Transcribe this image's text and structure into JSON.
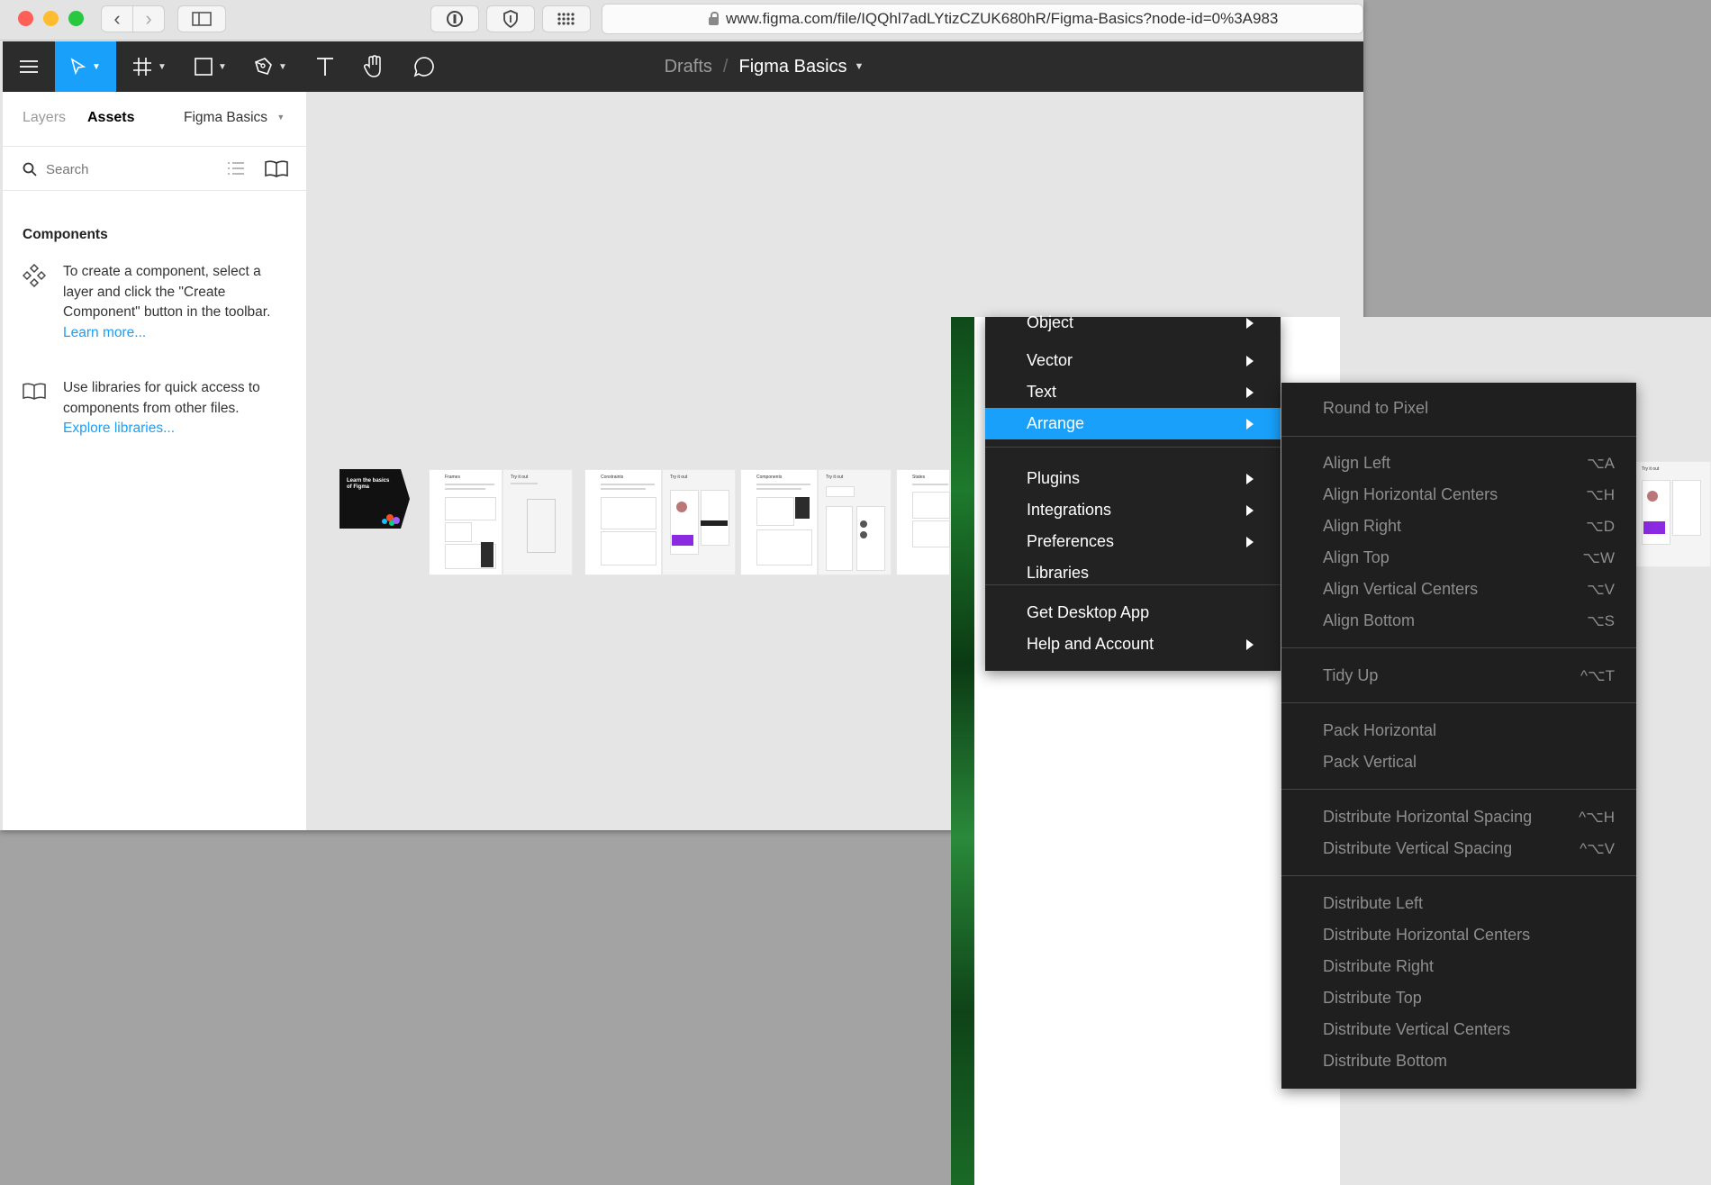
{
  "browser": {
    "url": "www.figma.com/file/IQQhl7adLYtizCZUK680hR/Figma-Basics?node-id=0%3A983",
    "traffic_colors": [
      "#fe5f57",
      "#febc2e",
      "#28c840"
    ]
  },
  "toolbar": {
    "crumb_parent": "Drafts",
    "crumb_separator": "/",
    "crumb_current": "Figma Basics",
    "accent": "#18a0fb"
  },
  "left_panel": {
    "tab_layers": "Layers",
    "tab_assets": "Assets",
    "file_name": "Figma Basics",
    "search_placeholder": "Search",
    "components_heading": "Components",
    "components_text": "To create a component, select a layer and click the \"Create Component\" button in the toolbar.",
    "components_link": "Learn more...",
    "libraries_text": "Use libraries for quick access to components from other files.",
    "libraries_link": "Explore libraries..."
  },
  "canvas": {
    "cover_title": "Learn the basics of Figma",
    "frame_titles": [
      "Frames",
      "Try it out",
      "Constraints",
      "Try it out",
      "Components",
      "Try it out",
      "States"
    ]
  },
  "main_menu": {
    "cut_off_item": "Object",
    "items": [
      {
        "label": "Vector",
        "submenu": true
      },
      {
        "label": "Text",
        "submenu": true
      },
      {
        "label": "Arrange",
        "submenu": true,
        "highlighted": true
      },
      {
        "label": "Plugins",
        "submenu": true
      },
      {
        "label": "Integrations",
        "submenu": true
      },
      {
        "label": "Preferences",
        "submenu": true
      },
      {
        "label": "Libraries",
        "submenu": false
      },
      {
        "label": "Get Desktop App",
        "submenu": false
      },
      {
        "label": "Help and Account",
        "submenu": true
      }
    ]
  },
  "arrange_submenu": {
    "items": [
      {
        "label": "Round to Pixel",
        "shortcut": ""
      },
      {
        "label": "Align Left",
        "shortcut": "⌥A"
      },
      {
        "label": "Align Horizontal Centers",
        "shortcut": "⌥H"
      },
      {
        "label": "Align Right",
        "shortcut": "⌥D"
      },
      {
        "label": "Align Top",
        "shortcut": "⌥W"
      },
      {
        "label": "Align Vertical Centers",
        "shortcut": "⌥V"
      },
      {
        "label": "Align Bottom",
        "shortcut": "⌥S"
      },
      {
        "label": "Tidy Up",
        "shortcut": "^⌥T"
      },
      {
        "label": "Pack Horizontal",
        "shortcut": ""
      },
      {
        "label": "Pack Vertical",
        "shortcut": ""
      },
      {
        "label": "Distribute Horizontal Spacing",
        "shortcut": "^⌥H"
      },
      {
        "label": "Distribute Vertical Spacing",
        "shortcut": "^⌥V"
      },
      {
        "label": "Distribute Left",
        "shortcut": ""
      },
      {
        "label": "Distribute Horizontal Centers",
        "shortcut": ""
      },
      {
        "label": "Distribute Right",
        "shortcut": ""
      },
      {
        "label": "Distribute Top",
        "shortcut": ""
      },
      {
        "label": "Distribute Vertical Centers",
        "shortcut": ""
      },
      {
        "label": "Distribute Bottom",
        "shortcut": ""
      }
    ]
  }
}
